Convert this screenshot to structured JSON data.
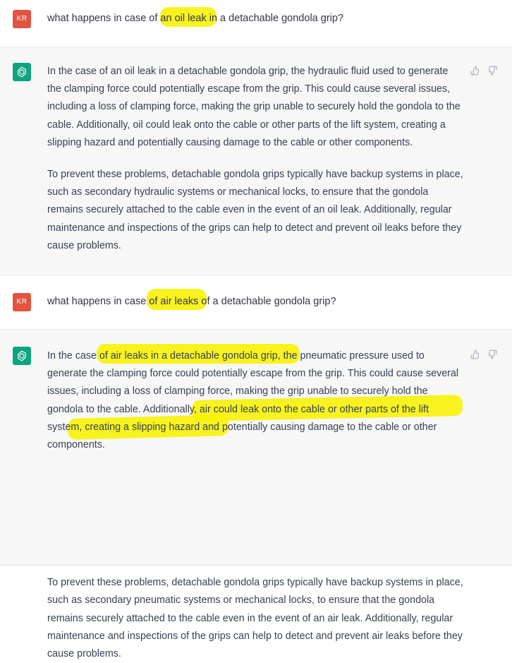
{
  "conversation": [
    {
      "role": "user",
      "avatar_initials": "KR",
      "text": "what happens in case of an oil leak in a detachable gondola grip?"
    },
    {
      "role": "assistant",
      "paragraphs": [
        "In the case of an oil leak in a detachable gondola grip, the hydraulic fluid used to generate the clamping force could potentially escape from the grip. This could cause several issues, including a loss of clamping force, making the grip unable to securely hold the gondola to the cable. Additionally, oil could leak onto the cable or other parts of the lift system, creating a slipping hazard and potentially causing damage to the cable or other components.",
        "To prevent these problems, detachable gondola grips typically have backup systems in place, such as secondary hydraulic systems or mechanical locks, to ensure that the gondola remains securely attached to the cable even in the event of an oil leak. Additionally, regular maintenance and inspections of the grips can help to detect and prevent oil leaks before they cause problems."
      ]
    },
    {
      "role": "user",
      "avatar_initials": "KR",
      "text": "what happens in case of air leaks of a detachable gondola grip?"
    },
    {
      "role": "assistant",
      "paragraphs": [
        "In the case of air leaks in a detachable gondola grip, the pneumatic pressure used to generate the clamping force could potentially escape from the grip. This could cause several issues, including a loss of clamping force, making the grip unable to securely hold the gondola to the cable. Additionally, air could leak onto the cable or other parts of the lift system, creating a slipping hazard and potentially causing damage to the cable or other components.",
        "To prevent these problems, detachable gondola grips typically have backup systems in place, such as secondary pneumatic systems or mechanical locks, to ensure that the gondola remains securely attached to the cable even in the event of an air leak. Additionally, regular maintenance and inspections of the grips can help to detect and prevent air leaks before they cause problems."
      ]
    }
  ],
  "icons": {
    "assistant_avatar": "openai-logo-icon",
    "feedback_up": "thumbs-up-icon",
    "feedback_down": "thumbs-down-icon"
  },
  "colors": {
    "user_avatar": "#e3533f",
    "assistant_avatar": "#10a37f",
    "assistant_bg": "#f7f7f8",
    "highlight": "#f7f207"
  }
}
